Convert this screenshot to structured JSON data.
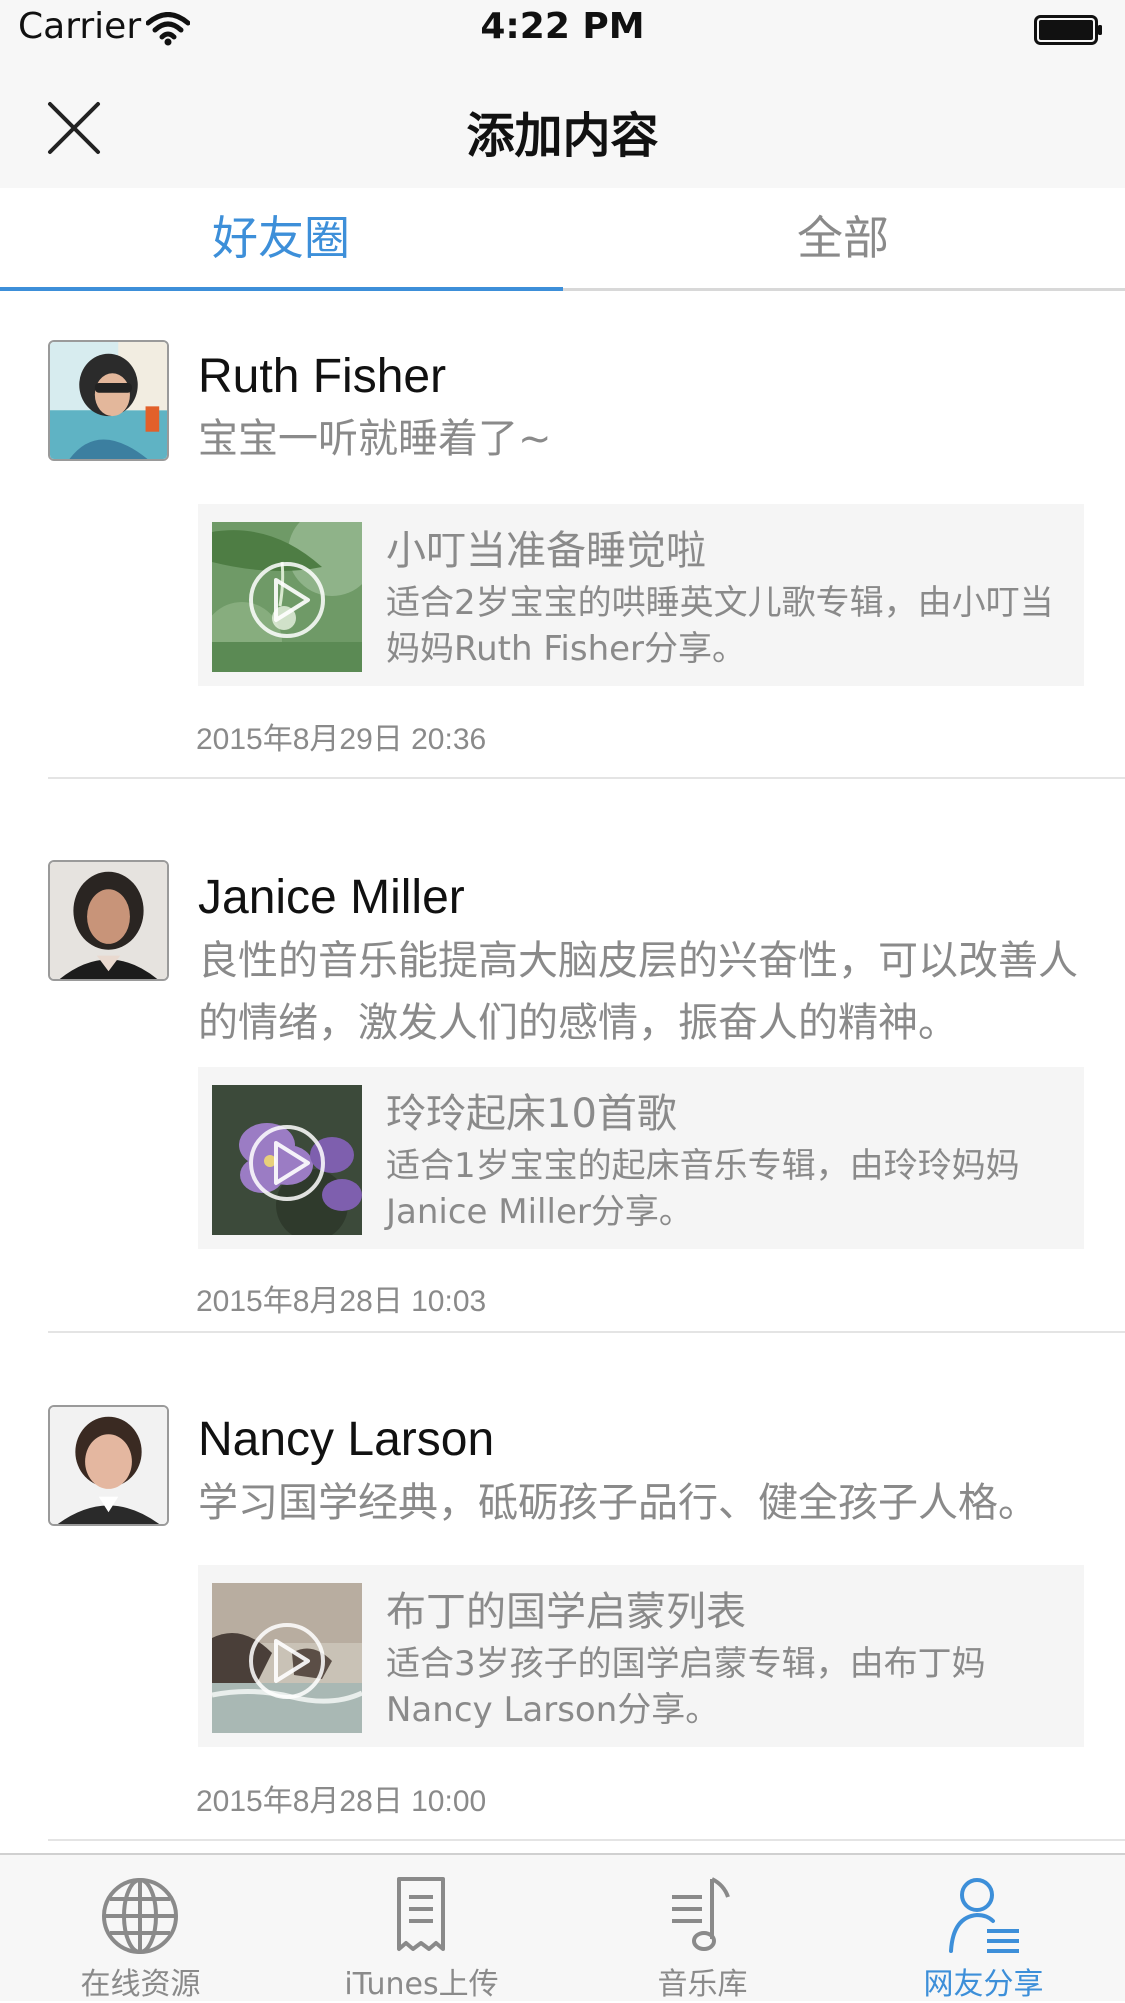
{
  "status_bar": {
    "carrier": "Carrier",
    "time": "4:22 PM"
  },
  "nav": {
    "title": "添加内容"
  },
  "tabs": [
    {
      "label": "好友圈",
      "active": true
    },
    {
      "label": "全部",
      "active": false
    }
  ],
  "posts": [
    {
      "author": "Ruth Fisher",
      "message": "宝宝一听就睡着了~",
      "album": {
        "title": "小叮当准备睡觉啦",
        "description": "适合2岁宝宝的哄睡英文儿歌专辑，由小叮当妈妈Ruth Fisher分享。"
      },
      "timestamp": "2015年8月29日 20:36"
    },
    {
      "author": "Janice Miller",
      "message": "良性的音乐能提高大脑皮层的兴奋性，可以改善人的情绪，激发人们的感情，振奋人的精神。",
      "album": {
        "title": "玲玲起床10首歌",
        "description": "适合1岁宝宝的起床音乐专辑，由玲玲妈妈Janice Miller分享。"
      },
      "timestamp": "2015年8月28日 10:03"
    },
    {
      "author": "Nancy Larson",
      "message": "学习国学经典，砥砺孩子品行、健全孩子人格。",
      "album": {
        "title": "布丁的国学启蒙列表",
        "description": "适合3岁孩子的国学启蒙专辑，由布丁妈Nancy Larson分享。"
      },
      "timestamp": "2015年8月28日 10:00"
    }
  ],
  "tab_bar": [
    {
      "label": "在线资源",
      "icon": "globe-icon",
      "active": false
    },
    {
      "label": "iTunes上传",
      "icon": "receipt-icon",
      "active": false
    },
    {
      "label": "音乐库",
      "icon": "music-list-icon",
      "active": false
    },
    {
      "label": "网友分享",
      "icon": "user-share-icon",
      "active": true
    }
  ],
  "colors": {
    "accent": "#3d8fd9",
    "text_secondary": "#8a8a8a",
    "bar_background": "#f7f7f7"
  }
}
